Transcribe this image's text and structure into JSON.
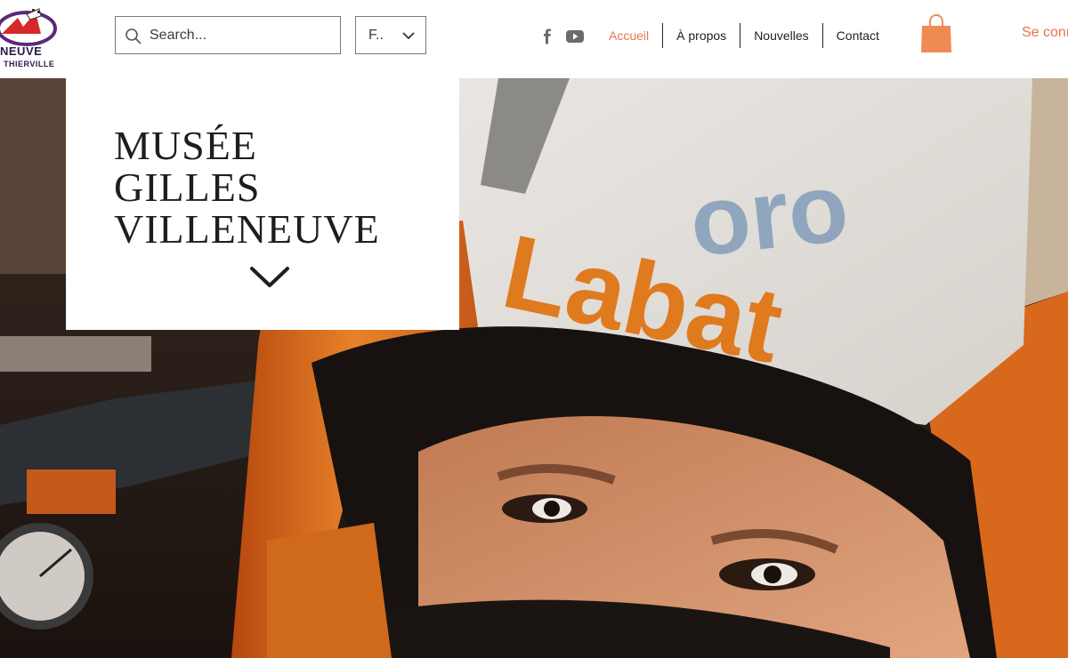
{
  "header": {
    "logo": {
      "line1": "NEUVE",
      "line2": "THIERVILLE"
    },
    "search": {
      "placeholder": "Search..."
    },
    "language": {
      "value": "F.."
    },
    "social": [
      {
        "icon": "facebook-icon"
      },
      {
        "icon": "youtube-icon"
      }
    ],
    "nav": [
      {
        "label": "Accueil",
        "active": true
      },
      {
        "label": "À propos",
        "active": false
      },
      {
        "label": "Nouvelles",
        "active": false
      },
      {
        "label": "Contact",
        "active": false
      }
    ],
    "cart_icon": "shopping-bag-icon",
    "login_label": "Se conn"
  },
  "hero": {
    "title_lines": [
      "MUSÉE",
      "GILLES",
      "VILLENEUVE"
    ],
    "scroll_icon": "chevron-down-icon",
    "helmet_text_1": "Labat",
    "helmet_text_2": "oro"
  },
  "colors": {
    "accent": "#e8734a",
    "text": "#222222",
    "helmet_orange": "#e07a1e"
  }
}
